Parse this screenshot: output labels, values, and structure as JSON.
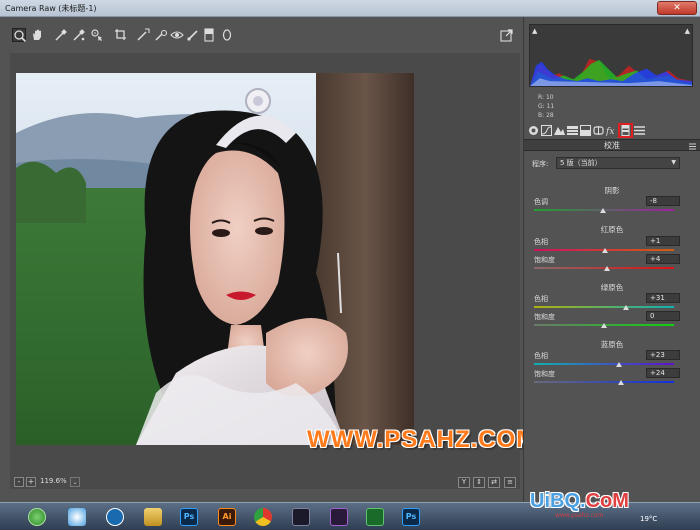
{
  "window": {
    "title": "Camera Raw (未标题-1)",
    "close_label": "✕"
  },
  "toolbar": {
    "tools": [
      "zoom-icon",
      "hand-icon",
      "white-balance-icon",
      "color-sampler-icon",
      "target-adjust-icon",
      "crop-icon",
      "straighten-icon",
      "spot-removal-icon",
      "red-eye-icon",
      "adjustment-brush-icon",
      "graduated-filter-icon",
      "radial-filter-icon"
    ],
    "export_icon": "open-preferences-icon"
  },
  "image": {
    "watermark": "WWW.PSAHZ.COM"
  },
  "bottombar": {
    "zoom_minus": "-",
    "zoom_plus": "+",
    "zoom_value": "119.6%",
    "zoom_caret": "⌄",
    "view_buttons": [
      "Y",
      "⇕",
      "⇄",
      "≡"
    ]
  },
  "histogram": {
    "r_label": "R:",
    "g_label": "G:",
    "b_label": "B:",
    "r_value": "10",
    "g_value": "11",
    "b_value": "28"
  },
  "panel": {
    "tabs": [
      "basic-icon",
      "tone-curve-icon",
      "detail-icon",
      "hsl-icon",
      "split-toning-icon",
      "lens-corrections-icon",
      "effects-icon",
      "camera-calibration-icon",
      "presets-icon"
    ],
    "selected_tab": 7,
    "section_title": "校准",
    "process_label": "程序:",
    "process_value": "5 版（当前）",
    "process_caret": "▼"
  },
  "calibration": {
    "shadows": {
      "title": "阴影",
      "tint_label": "色调",
      "tint_value": "-8",
      "tint_pos": 0.49
    },
    "red": {
      "title": "红原色",
      "hue_label": "色相",
      "hue_value": "+1",
      "hue_pos": 0.51,
      "sat_label": "饱和度",
      "sat_value": "+4",
      "sat_pos": 0.52
    },
    "green": {
      "title": "绿原色",
      "hue_label": "色相",
      "hue_value": "+31",
      "hue_pos": 0.66,
      "sat_label": "饱和度",
      "sat_value": "0",
      "sat_pos": 0.5
    },
    "blue": {
      "title": "蓝原色",
      "hue_label": "色相",
      "hue_value": "+23",
      "hue_pos": 0.61,
      "sat_label": "饱和度",
      "sat_value": "+24",
      "sat_pos": 0.62
    }
  },
  "taskbar": {
    "apps": [
      "start-orb-icon",
      "ie-icon",
      "network-icon",
      "k-app-icon",
      "folder-icon",
      "photoshop-icon",
      "illustrator-icon",
      "chrome-icon",
      "ps-cs-icon",
      "pr-icon",
      "excel-icon",
      "photoshop-2-icon"
    ],
    "ps_label": "Ps",
    "ai_label": "Ai",
    "temperature": "19°C"
  },
  "tray_watermark": {
    "main_a": "UiBQ.",
    "main_b": "CoM",
    "sub": "www.psahz.com"
  },
  "colors": {
    "accent_red": "#e02020",
    "watermark_orange": "#ff7a1a"
  }
}
